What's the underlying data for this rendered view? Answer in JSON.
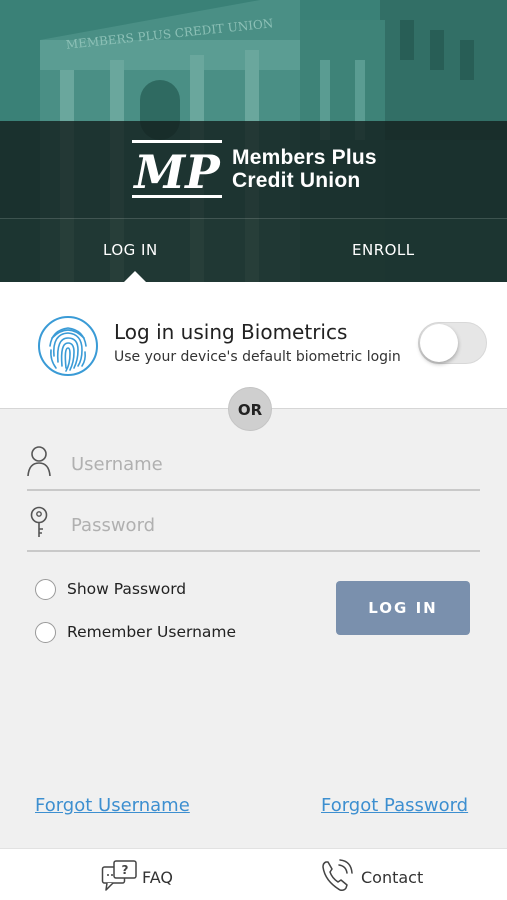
{
  "brand": {
    "logo_initials": "MP",
    "name_line1": "Members Plus",
    "name_line2": "Credit Union",
    "building_sign": "MEMBERS PLUS CREDIT UNION"
  },
  "tabs": [
    {
      "label": "LOG IN",
      "selected": true
    },
    {
      "label": "ENROLL",
      "selected": false
    }
  ],
  "biometrics": {
    "title": "Log in using Biometrics",
    "subtitle": "Use your device's default biometric login",
    "enabled": false,
    "icon": "fingerprint-icon"
  },
  "divider": {
    "label": "OR"
  },
  "form": {
    "username": {
      "value": "",
      "placeholder": "Username",
      "icon": "user-icon"
    },
    "password": {
      "value": "",
      "placeholder": "Password",
      "icon": "key-icon"
    },
    "show_password": {
      "label": "Show Password",
      "checked": false
    },
    "remember_username": {
      "label": "Remember Username",
      "checked": false
    },
    "login_button": "LOG IN"
  },
  "links": {
    "forgot_username": "Forgot Username",
    "forgot_password": "Forgot Password"
  },
  "bottom_nav": [
    {
      "label": "FAQ",
      "icon": "faq-chat-icon"
    },
    {
      "label": "Contact",
      "icon": "phone-icon"
    }
  ],
  "colors": {
    "accent_link": "#3d8fd0",
    "login_button": "#7a90ad",
    "fingerprint": "#3a9bd6",
    "header_teal": "#2f6e66"
  }
}
